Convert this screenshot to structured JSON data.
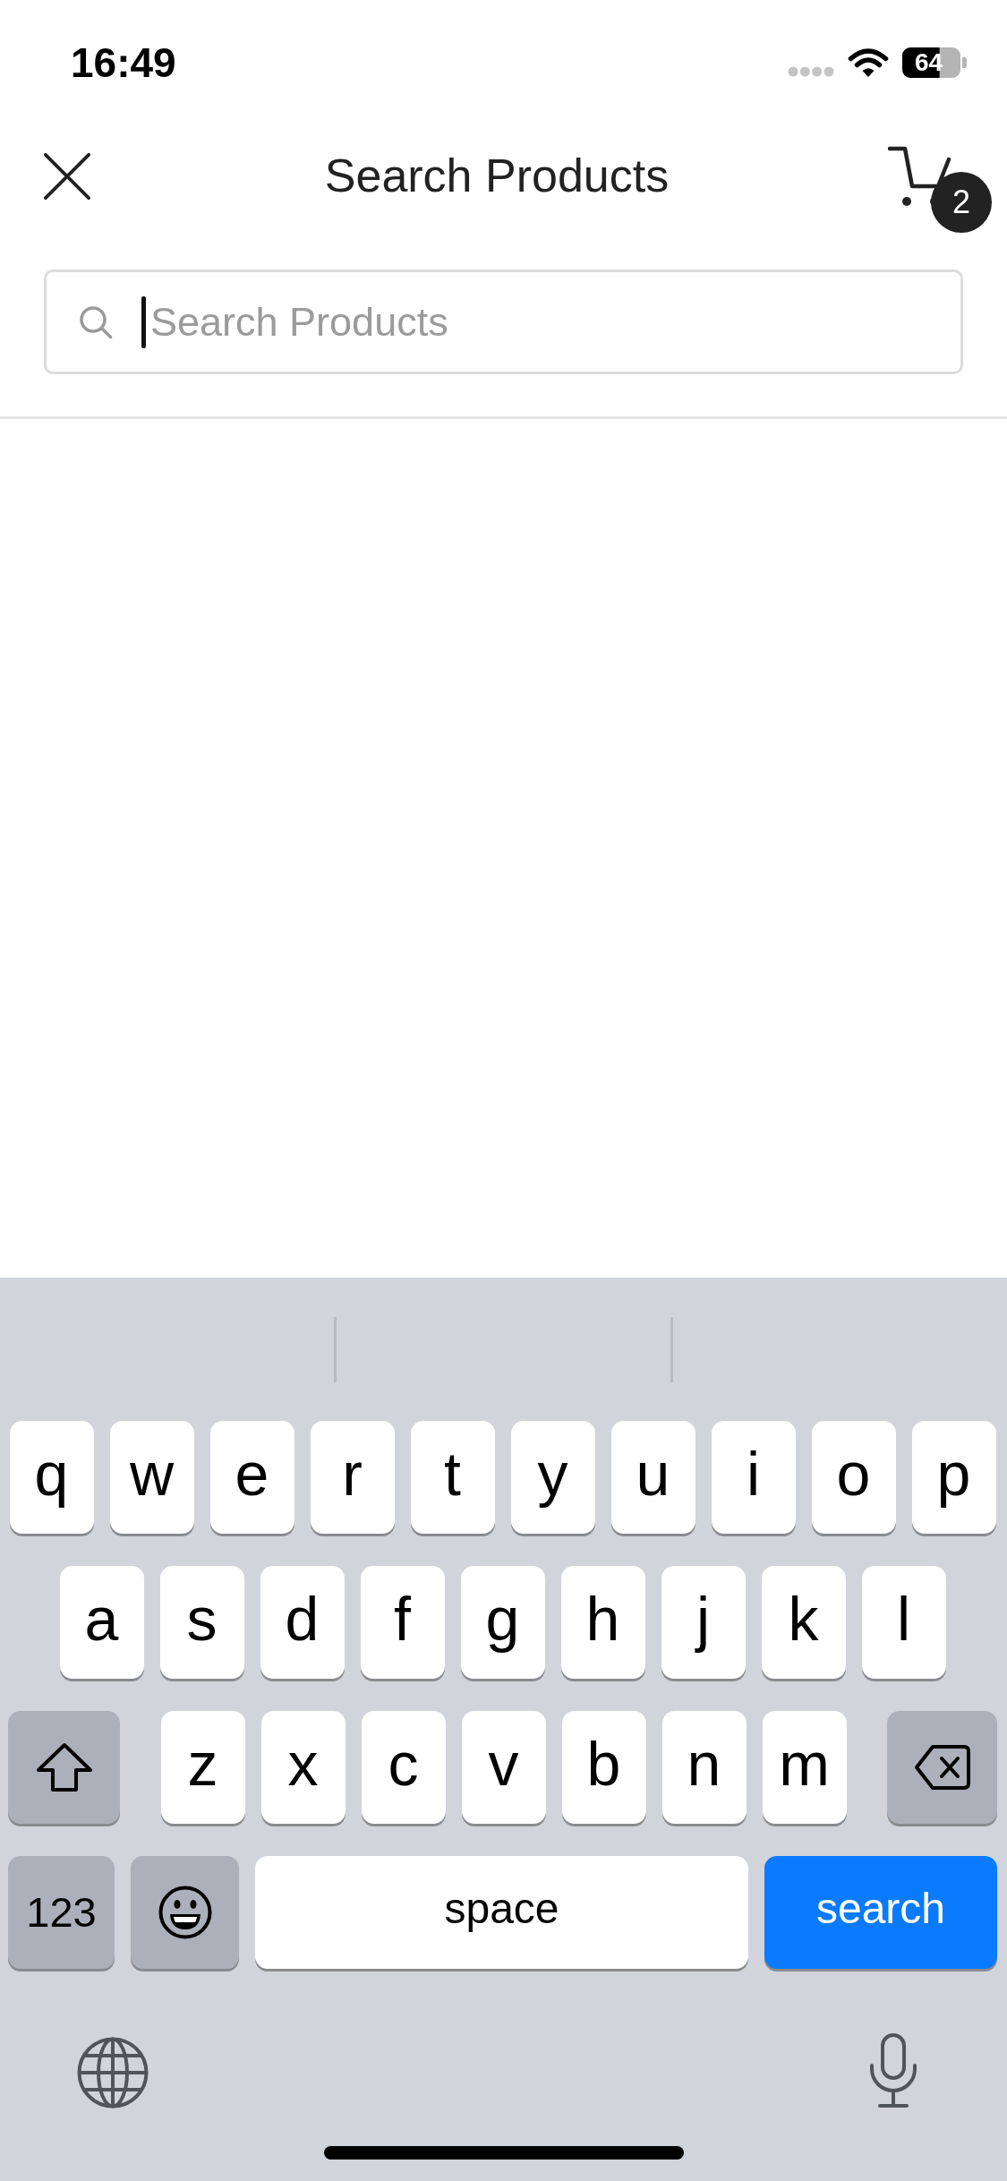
{
  "status_bar": {
    "time": "16:49",
    "battery": "64"
  },
  "header": {
    "title": "Search Products",
    "cart_badge": "2"
  },
  "search": {
    "placeholder": "Search Products",
    "focused": true
  },
  "keyboard": {
    "rows": [
      {
        "keys": [
          {
            "kind": "letter",
            "label": "q"
          },
          {
            "kind": "letter",
            "label": "w"
          },
          {
            "kind": "letter",
            "label": "e"
          },
          {
            "kind": "letter",
            "label": "r"
          },
          {
            "kind": "letter",
            "label": "t"
          },
          {
            "kind": "letter",
            "label": "y"
          },
          {
            "kind": "letter",
            "label": "u"
          },
          {
            "kind": "letter",
            "label": "i"
          },
          {
            "kind": "letter",
            "label": "o"
          },
          {
            "kind": "letter",
            "label": "p"
          }
        ]
      },
      {
        "keys": [
          {
            "kind": "letter",
            "label": "a"
          },
          {
            "kind": "letter",
            "label": "s"
          },
          {
            "kind": "letter",
            "label": "d"
          },
          {
            "kind": "letter",
            "label": "f"
          },
          {
            "kind": "letter",
            "label": "g"
          },
          {
            "kind": "letter",
            "label": "h"
          },
          {
            "kind": "letter",
            "label": "j"
          },
          {
            "kind": "letter",
            "label": "k"
          },
          {
            "kind": "letter",
            "label": "l"
          }
        ]
      },
      {
        "keys": [
          {
            "kind": "shift"
          },
          {
            "kind": "letter",
            "label": "z"
          },
          {
            "kind": "letter",
            "label": "x"
          },
          {
            "kind": "letter",
            "label": "c"
          },
          {
            "kind": "letter",
            "label": "v"
          },
          {
            "kind": "letter",
            "label": "b"
          },
          {
            "kind": "letter",
            "label": "n"
          },
          {
            "kind": "letter",
            "label": "m"
          },
          {
            "kind": "delete"
          }
        ]
      },
      {
        "keys": [
          {
            "kind": "numbers",
            "label": "123"
          },
          {
            "kind": "emoji"
          },
          {
            "kind": "space",
            "label": "space"
          },
          {
            "kind": "action",
            "label": "search"
          }
        ]
      }
    ]
  }
}
